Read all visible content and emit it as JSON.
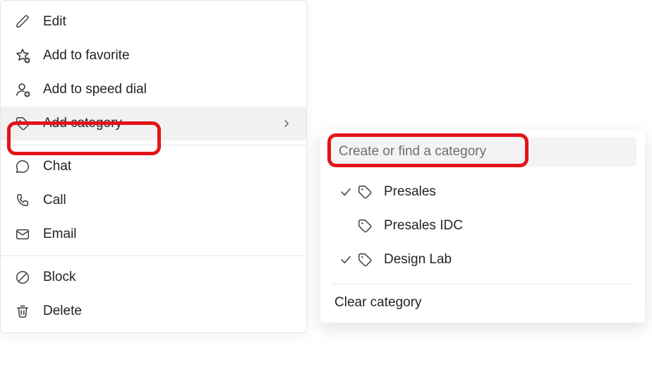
{
  "menu": {
    "edit": {
      "label": "Edit",
      "icon": "edit-icon"
    },
    "favorite": {
      "label": "Add to favorite",
      "icon": "star-add-icon"
    },
    "speed_dial": {
      "label": "Add to speed dial",
      "icon": "person-add-icon"
    },
    "add_category": {
      "label": "Add category",
      "icon": "tag-icon"
    },
    "chat": {
      "label": "Chat",
      "icon": "chat-icon"
    },
    "call": {
      "label": "Call",
      "icon": "call-icon"
    },
    "email": {
      "label": "Email",
      "icon": "mail-icon"
    },
    "block": {
      "label": "Block",
      "icon": "block-icon"
    },
    "delete": {
      "label": "Delete",
      "icon": "delete-icon"
    }
  },
  "flyout": {
    "search_placeholder": "Create or find a category",
    "categories": [
      {
        "label": "Presales",
        "checked": true
      },
      {
        "label": "Presales IDC",
        "checked": false
      },
      {
        "label": "Design Lab",
        "checked": true
      }
    ],
    "clear_label": "Clear category"
  },
  "colors": {
    "highlight_border": "#e3141a",
    "hover_bg": "#f1f1f1",
    "input_bg": "#f3f3f3",
    "text": "#242424",
    "placeholder": "#6e6e6e",
    "stroke": "#3b3b3b"
  }
}
